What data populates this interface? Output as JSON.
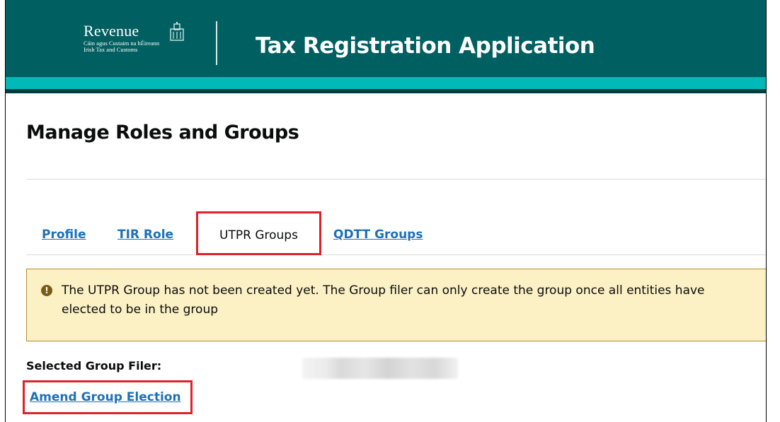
{
  "header": {
    "logo": {
      "wordmark": "Revenue",
      "subtitle_irish": "Cáin agus Custaim na hÉireann",
      "subtitle_english": "Irish Tax and Customs",
      "emblem_icon": "customs-house-icon"
    },
    "app_title": "Tax Registration Application"
  },
  "page": {
    "title": "Manage Roles and Groups"
  },
  "tabs": [
    {
      "label": "Profile",
      "state": "link"
    },
    {
      "label": "TIR Role",
      "state": "link"
    },
    {
      "label": "UTPR Groups",
      "state": "active"
    },
    {
      "label": "QDTT Groups",
      "state": "link"
    }
  ],
  "warning": {
    "icon": "exclamation-circle-icon",
    "text": "The UTPR Group has not been created yet. The Group filer can only create the group once all entities have elected to be in the group"
  },
  "filer": {
    "label": "Selected Group Filer:"
  },
  "actions": {
    "amend_label": "Amend Group Election"
  },
  "colors": {
    "header_teal": "#005f61",
    "header_accent": "#00b9b8",
    "link_blue": "#1d70b8",
    "warning_bg": "#fbf1c4",
    "highlight_red": "#e0202b"
  }
}
